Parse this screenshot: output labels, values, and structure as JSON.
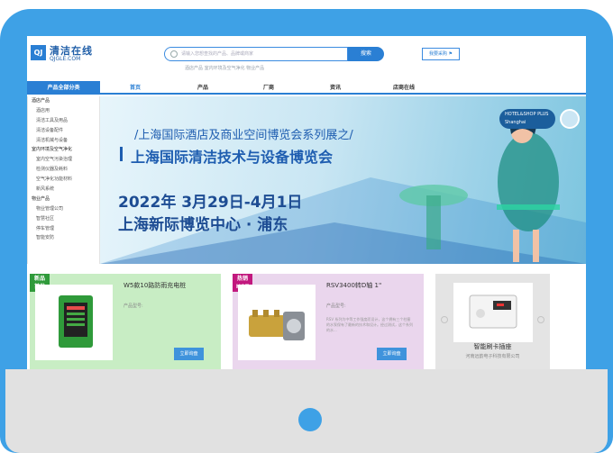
{
  "header": {
    "logo_mark": "QJ",
    "logo_cn": "清洁在线",
    "logo_en": "QJGLE.COM",
    "search_placeholder": "请输入您想查找的产品、品牌或商家",
    "search_button": "搜索",
    "hot_keywords": "酒店产品  室内环境及空气净化  物业产品",
    "buy_button": "我要采购"
  },
  "nav": {
    "category_label": "产品全部分类",
    "items": [
      "首页",
      "产品",
      "厂商",
      "资讯",
      "店商在线"
    ]
  },
  "sidebar": {
    "items": [
      {
        "label": "酒店产品",
        "head": true
      },
      {
        "label": "酒店用",
        "head": false
      },
      {
        "label": "清洁工具及用品",
        "head": false
      },
      {
        "label": "清洁设备配件",
        "head": false
      },
      {
        "label": "清洁机械与设备",
        "head": false
      },
      {
        "label": "室内环境及空气净化",
        "head": true
      },
      {
        "label": "室内空气污染治理",
        "head": false
      },
      {
        "label": "检测仪器及耗料",
        "head": false
      },
      {
        "label": "空气净化功能材料",
        "head": false
      },
      {
        "label": "新风系统",
        "head": false
      },
      {
        "label": "物业产品",
        "head": true
      },
      {
        "label": "物业管理公司",
        "head": false
      },
      {
        "label": "智慧社区",
        "head": false
      },
      {
        "label": "停车管理",
        "head": false
      },
      {
        "label": "智能安防",
        "head": false
      }
    ]
  },
  "banner": {
    "line1": "/上海国际酒店及商业空间博览会系列展之/",
    "line2": "上海国际清洁技术与设备博览会",
    "line3": "2022年 3月29日-4月1日",
    "line4": "上海新际博览中心 · 浦东",
    "logo_text_1": "HOTEL&SHOP PLUS",
    "logo_text_2": "Shanghai"
  },
  "products": [
    {
      "badge_1": "新品",
      "badge_2": "首发",
      "title": "W5款10路防雨充电桩",
      "model_label": "产品型号:",
      "desc": "",
      "inquire": "立即询盘"
    },
    {
      "badge_1": "热销",
      "badge_2": "HOT",
      "title": "RSV3400转D轴 1\"",
      "model_label": "产品型号:",
      "desc": "RSV 系列为中等工作强度而设计，这个拥有三个柱塞的水泵保有了最新的技术和设计。经过测试，这个系列的水...",
      "inquire": "立即询盘"
    },
    {
      "title": "智能刷卡插座",
      "company": "河南远韵电子科技有限公司"
    }
  ],
  "colors": {
    "device_frame": "#3ea1e6",
    "device_bottom": "#e1e1e1",
    "brand_blue": "#2a7fd4",
    "card_green": "#c8edc4",
    "card_purple": "#ead6ed"
  }
}
